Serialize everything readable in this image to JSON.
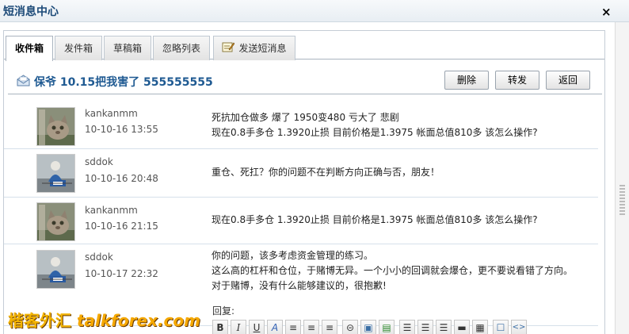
{
  "window": {
    "title": "短消息中心",
    "close_glyph": "×"
  },
  "tabs": [
    {
      "label": "收件箱",
      "active": true
    },
    {
      "label": "发件箱",
      "active": false
    },
    {
      "label": "草稿箱",
      "active": false
    },
    {
      "label": "忽略列表",
      "active": false
    },
    {
      "label": "发送短消息",
      "active": false,
      "icon": "compose-icon"
    }
  ],
  "header": {
    "subject": "保爷 10.15把我害了 555555555",
    "buttons": {
      "delete": "删除",
      "forward": "转发",
      "back": "返回"
    }
  },
  "messages": [
    {
      "sender": "kankanmm",
      "time": "10-10-16 13:55",
      "avatar": "cat-avatar",
      "lines": [
        "死抗加仓做多 爆了 1950变480 亏大了 悲剧",
        "现在0.8手多仓 1.3920止损 目前价格是1.3975 帐面总值810多 该怎么操作?"
      ]
    },
    {
      "sender": "sddok",
      "time": "10-10-16 20:48",
      "avatar": "figure-avatar",
      "lines": [
        "重仓、死扛？你的问题不在判断方向正确与否，朋友！"
      ]
    },
    {
      "sender": "kankanmm",
      "time": "10-10-16 21:15",
      "avatar": "cat-avatar",
      "lines": [
        "现在0.8手多仓 1.3920止损 目前价格是1.3975 帐面总值810多 该怎么操作?"
      ]
    },
    {
      "sender": "sddok",
      "time": "10-10-17 22:32",
      "avatar": "figure-avatar",
      "lines": [
        "你的问题，该多考虑资金管理的练习。",
        "这么高的杠杆和仓位，于赌博无异。一个小小的回调就会爆仓，更不要说看错了方向。",
        "对于赌博，没有什么能够建议的，很抱歉!"
      ]
    }
  ],
  "reply": {
    "label": "回复:",
    "toolbar": [
      {
        "name": "bold-icon",
        "glyph": "B"
      },
      {
        "name": "italic-icon",
        "glyph": "I"
      },
      {
        "name": "underline-icon",
        "glyph": "U"
      },
      {
        "name": "font-color-icon",
        "glyph": "A"
      },
      {
        "name": "align-left-icon",
        "glyph": "≡"
      },
      {
        "name": "align-center-icon",
        "glyph": "≡"
      },
      {
        "name": "align-right-icon",
        "glyph": "≡"
      },
      {
        "name": "link-icon",
        "glyph": "⊝"
      },
      {
        "name": "image-icon",
        "glyph": "▣"
      },
      {
        "name": "insert-media-icon",
        "glyph": "▤"
      },
      {
        "name": "ordered-list-icon",
        "glyph": "☰"
      },
      {
        "name": "unordered-list-icon",
        "glyph": "☰"
      },
      {
        "name": "indent-icon",
        "glyph": "☰"
      },
      {
        "name": "quote-icon",
        "glyph": "▬"
      },
      {
        "name": "table-icon",
        "glyph": "▦"
      },
      {
        "name": "emoticon-icon",
        "glyph": "☐"
      },
      {
        "name": "code-icon",
        "glyph": "<>"
      }
    ]
  },
  "watermark": {
    "chinese": "楷客外汇",
    "site": "talkforex.com"
  }
}
